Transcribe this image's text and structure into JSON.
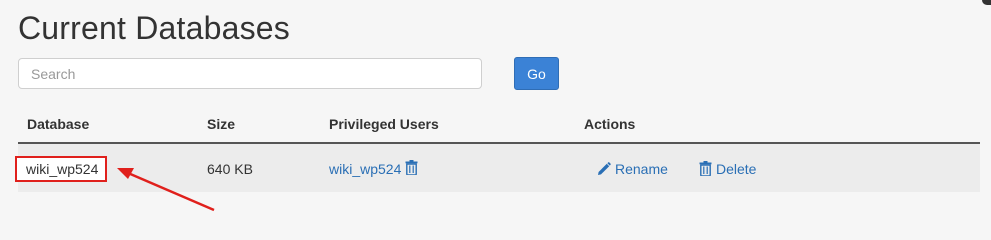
{
  "page": {
    "title": "Current Databases"
  },
  "search": {
    "placeholder": "Search",
    "value": "",
    "go_label": "Go"
  },
  "table": {
    "columns": [
      "Database",
      "Size",
      "Privileged Users",
      "Actions"
    ],
    "rows": [
      {
        "database": "wiki_wp524",
        "size": "640 KB",
        "privileged_user": "wiki_wp524",
        "actions": [
          "Rename",
          "Delete"
        ]
      }
    ]
  },
  "icons": {
    "user_remove": "trash-icon",
    "rename": "pencil-icon",
    "delete": "trash-icon"
  },
  "colors": {
    "link": "#2a6fb5",
    "go_button": "#3b82d6",
    "highlight_box": "#e0201c",
    "annotation_arrow": "#e0201c"
  }
}
